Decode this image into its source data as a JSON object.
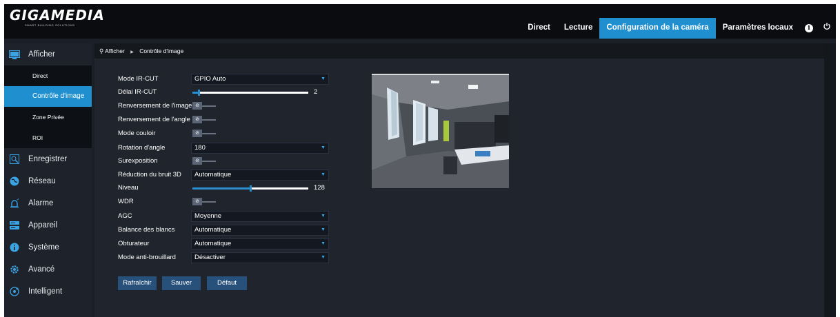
{
  "brand": {
    "name": "GIGAMEDIA",
    "tagline": "SMART BUILDING SOLUTIONS"
  },
  "topnav": {
    "items": [
      {
        "label": "Direct",
        "active": false
      },
      {
        "label": "Lecture",
        "active": false
      },
      {
        "label": "Configuration de la caméra",
        "active": true
      },
      {
        "label": "Paramètres locaux",
        "active": false
      }
    ],
    "info_icon": "info-icon",
    "power_icon": "power-icon",
    "accent_color": "#1f8fd0"
  },
  "sidebar": {
    "menus": [
      {
        "label": "Afficher",
        "icon": "display-icon"
      },
      {
        "label": "Enregistrer",
        "icon": "record-icon"
      },
      {
        "label": "Réseau",
        "icon": "network-icon"
      },
      {
        "label": "Alarme",
        "icon": "alarm-icon"
      },
      {
        "label": "Appareil",
        "icon": "device-icon"
      },
      {
        "label": "Système",
        "icon": "system-info-icon"
      },
      {
        "label": "Avancé",
        "icon": "gear-icon"
      },
      {
        "label": "Intelligent",
        "icon": "intelligent-icon"
      }
    ],
    "submenu": [
      {
        "label": "Direct",
        "active": false
      },
      {
        "label": "Contrôle d'image",
        "active": true
      },
      {
        "label": "Zone Privée",
        "active": false
      },
      {
        "label": "ROI",
        "active": false
      }
    ]
  },
  "breadcrumb": {
    "root": "Afficher",
    "current": "Contrôle d'image"
  },
  "form": {
    "ircut_mode": {
      "label": "Mode IR-CUT",
      "value": "GPIO Auto"
    },
    "ircut_delay": {
      "label": "Délai IR-CUT",
      "value": 2,
      "min": 0,
      "max": 36
    },
    "image_flip": {
      "label": "Renversement de l'image",
      "on": false
    },
    "angle_flip": {
      "label": "Renversement de l'angle",
      "on": false
    },
    "corridor_mode": {
      "label": "Mode couloir",
      "on": false
    },
    "rotation": {
      "label": "Rotation d'angle",
      "value": "180"
    },
    "overexposure": {
      "label": "Surexposition",
      "on": false
    },
    "noise_3d": {
      "label": "Réduction du bruit 3D",
      "value": "Automatique"
    },
    "level": {
      "label": "Niveau",
      "value": 128,
      "min": 0,
      "max": 255
    },
    "wdr": {
      "label": "WDR",
      "on": false
    },
    "agc": {
      "label": "AGC",
      "value": "Moyenne"
    },
    "white_balance": {
      "label": "Balance des blancs",
      "value": "Automatique"
    },
    "shutter": {
      "label": "Obturateur",
      "value": "Automatique"
    },
    "antifog": {
      "label": "Mode anti-brouillard",
      "value": "Désactiver"
    }
  },
  "buttons": {
    "refresh": "Rafraîchir",
    "save": "Sauver",
    "default": "Défaut"
  }
}
